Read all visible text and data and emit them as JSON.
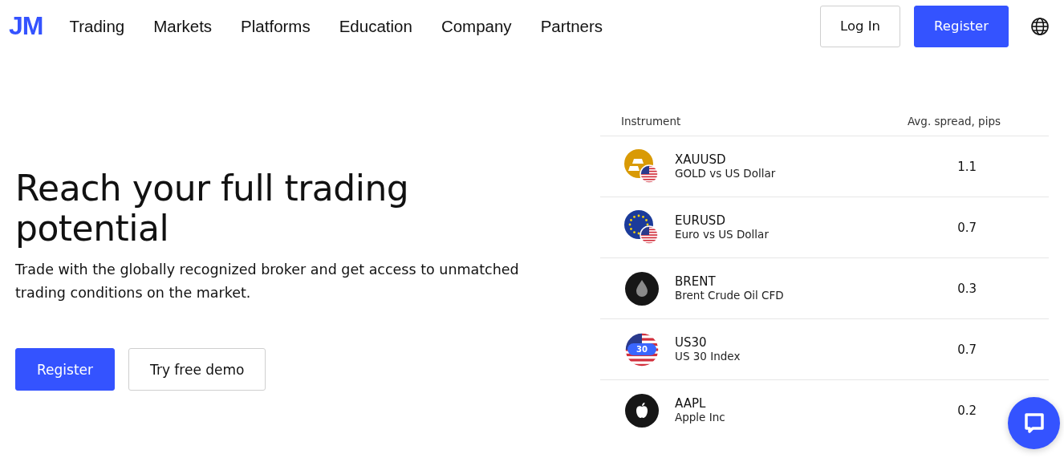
{
  "header": {
    "logo": "JM",
    "nav": [
      "Trading",
      "Markets",
      "Platforms",
      "Education",
      "Company",
      "Partners"
    ],
    "login": "Log In",
    "register": "Register"
  },
  "hero": {
    "title": "Reach your full trading potential",
    "subtitle": "Trade with the globally recognized broker and get access to unmatched trading conditions on the market.",
    "primary": "Register",
    "secondary": "Try free demo"
  },
  "table": {
    "columns": [
      "Instrument",
      "Avg. spread, pips"
    ],
    "rows": [
      {
        "kind": "gold",
        "symbol": "XAUUSD",
        "name": "GOLD vs US Dollar",
        "spread": "1.1"
      },
      {
        "kind": "euro",
        "symbol": "EURUSD",
        "name": "Euro vs US Dollar",
        "spread": "0.7"
      },
      {
        "kind": "oil",
        "symbol": "BRENT",
        "name": "Brent Crude Oil CFD",
        "spread": "0.3"
      },
      {
        "kind": "index",
        "symbol": "US30",
        "name": "US 30 Index",
        "spread": "0.7",
        "badge": "30"
      },
      {
        "kind": "apple",
        "symbol": "AAPL",
        "name": "Apple Inc",
        "spread": "0.2"
      }
    ]
  }
}
